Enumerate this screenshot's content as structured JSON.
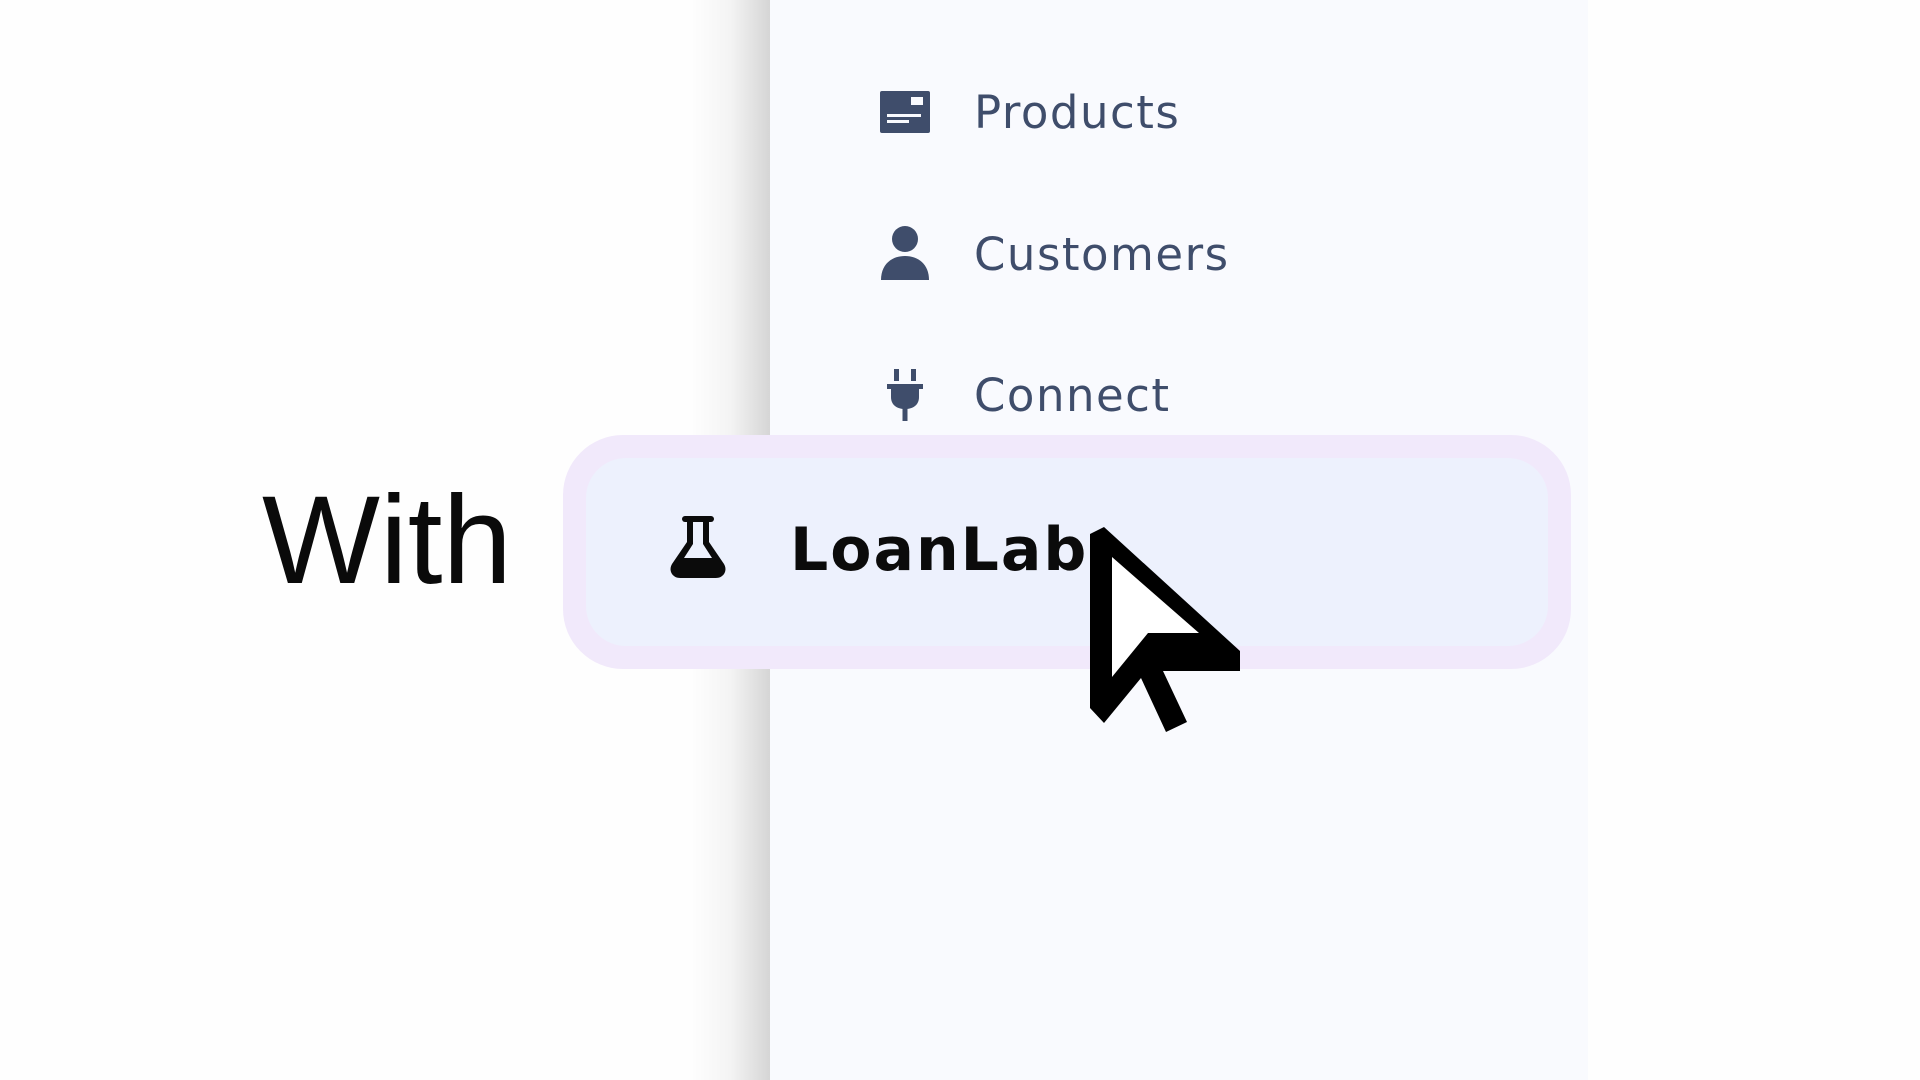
{
  "caption": {
    "text": "With"
  },
  "sidebar": {
    "items": [
      {
        "label": "Products",
        "icon": "product-card-icon"
      },
      {
        "label": "Customers",
        "icon": "person-icon"
      },
      {
        "label": "Connect",
        "icon": "plug-icon"
      }
    ],
    "highlighted": {
      "label": "LoanLab",
      "icon": "flask-icon"
    }
  },
  "colors": {
    "sidebar_background": "#f9fafe",
    "nav_text": "#3f4d6b",
    "highlight_ring": "#f1e9fb",
    "highlight_fill": "#edf1fd",
    "highlight_text": "#0b0b0b"
  },
  "cursor": {
    "icon": "arrow-cursor-icon"
  }
}
